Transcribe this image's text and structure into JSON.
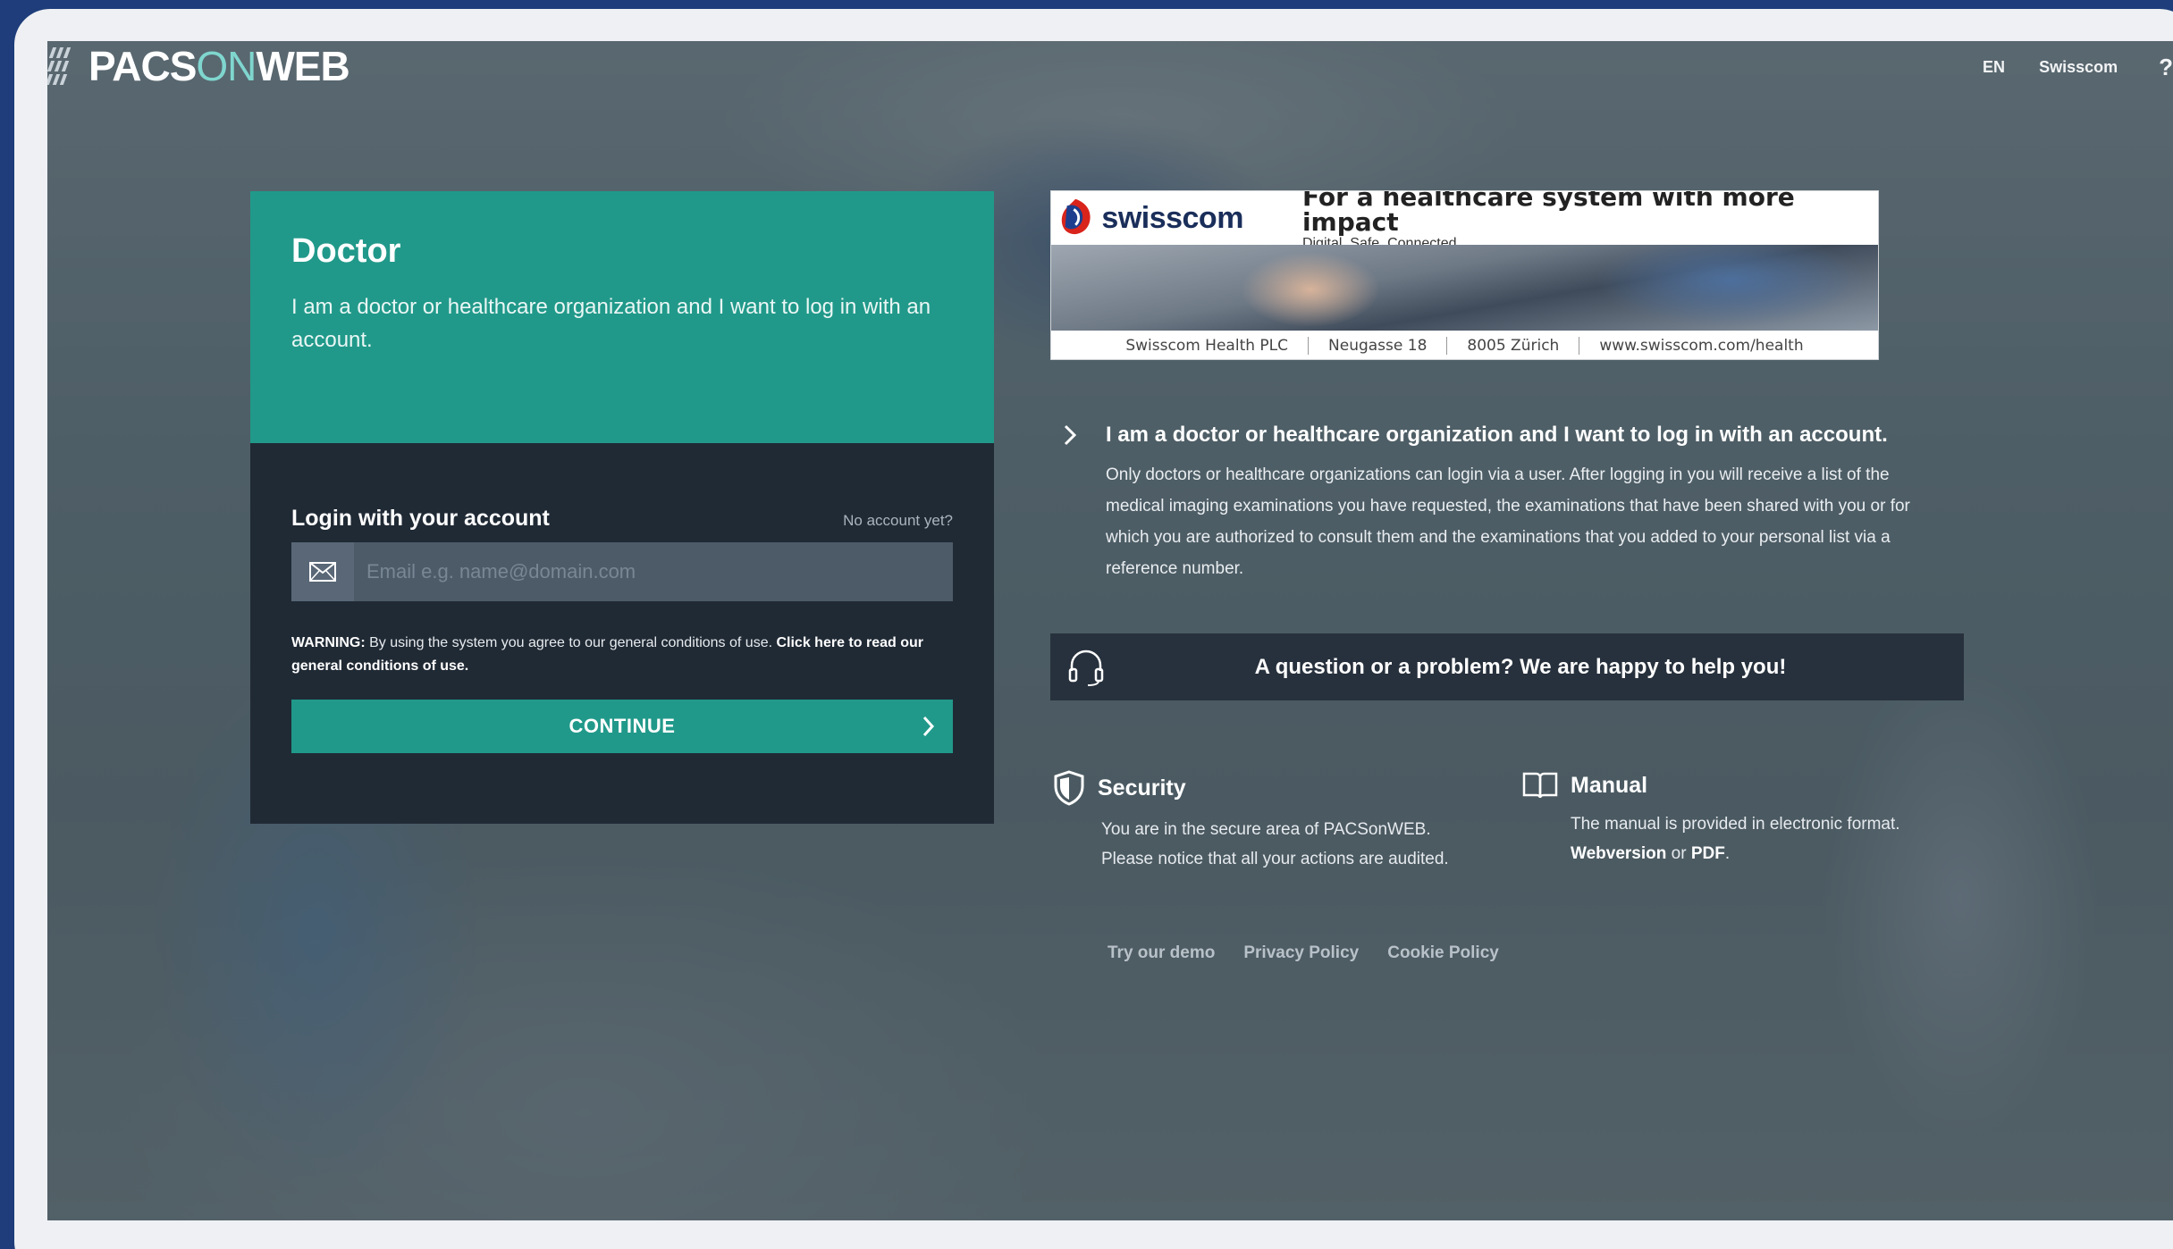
{
  "header": {
    "logo_pacs": "PACS",
    "logo_on": "ON",
    "logo_web": "WEB",
    "language": "EN",
    "organization": "Swisscom",
    "help_label": "?"
  },
  "login_card": {
    "title": "Doctor",
    "description": "I am a doctor or healthcare organization and I want to log in with an account.",
    "login_heading": "Login with your account",
    "no_account_link": "No account yet?",
    "email_placeholder": "Email e.g. name@domain.com",
    "email_value": "",
    "warning_label": "WARNING:",
    "warning_text": " By using the system you agree to our general conditions of use. ",
    "warning_link": "Click here to read our general conditions of use.",
    "continue_label": "CONTINUE"
  },
  "banner": {
    "brand": "swisscom",
    "tagline": "For a healthcare system with more impact",
    "subtagline": "Digital. Safe. Connected.",
    "footer": [
      "Swisscom Health PLC",
      "Neugasse 18",
      "8005 Zürich",
      "www.swisscom.com/health"
    ]
  },
  "info": {
    "title": "I am a doctor or healthcare organization and I want to log in with an account.",
    "description": "Only doctors or healthcare organizations can login via a user. After logging in you will receive a list of the medical imaging examinations you have requested, the examinations that have been shared with you or for which you are authorized to consult them and the examinations that you added to your personal list via a reference number."
  },
  "help_bar": {
    "text": "A question or a problem? We are happy to help you!"
  },
  "security": {
    "title": "Security",
    "line1": "You are in the secure area of PACSonWEB.",
    "line2": "Please notice that all your actions are audited."
  },
  "manual": {
    "title": "Manual",
    "line1": "The manual is provided in electronic format.",
    "webversion": "Webversion",
    "or": " or ",
    "pdf": "PDF",
    "end": "."
  },
  "footer_links": [
    "Try our demo",
    "Privacy Policy",
    "Cookie Policy"
  ],
  "colors": {
    "accent": "#21998a",
    "card_dark": "#202a35",
    "page_frame": "#1e3d7a"
  }
}
